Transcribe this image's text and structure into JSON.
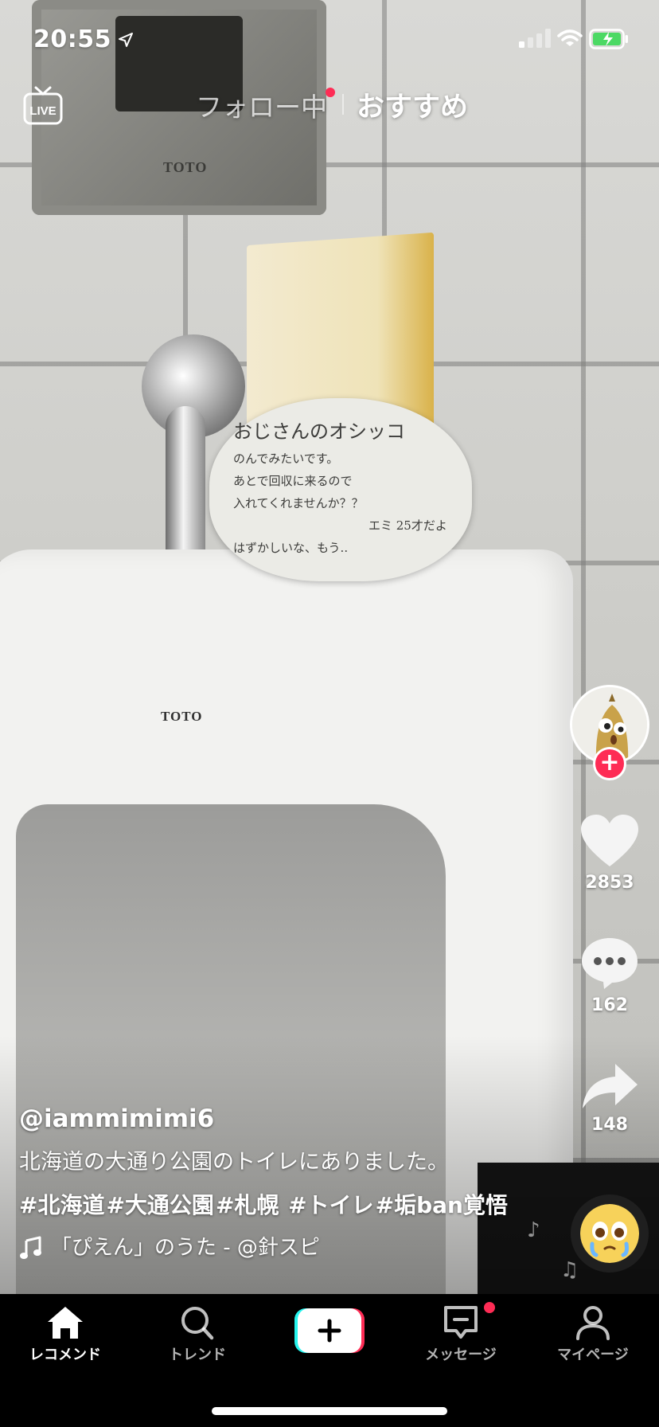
{
  "status_bar": {
    "time": "20:55"
  },
  "top_nav": {
    "live_label": "LIVE",
    "following_tab": "フォロー中",
    "recommended_tab": "おすすめ"
  },
  "video": {
    "scene_text": {
      "brand_top": "TOTO",
      "brand_bowl": "TOTO",
      "note_lines": [
        "おじさんのオシッコ",
        "のんでみたいです。",
        "あとで回収に来るので",
        "入れてくれませんか？？",
        "エミ 25才だよ",
        "はずかしいな、もう.."
      ]
    }
  },
  "actions": {
    "like_count": "2853",
    "comment_count": "162",
    "share_count": "148",
    "follow_symbol": "+"
  },
  "caption": {
    "username": "@iammimimi6",
    "description": "北海道の大通り公園のトイレにありました。",
    "hashtags": [
      "#北海道",
      "#大通公園",
      "#札幌",
      " #トイレ",
      "#垢ban覚悟"
    ],
    "sound": "「ぴえん」のうた - @針スピ"
  },
  "bottom_nav": {
    "home": "レコメンド",
    "discover": "トレンド",
    "inbox": "メッセージ",
    "profile": "マイページ"
  },
  "colors": {
    "accent": "#fe2c55",
    "create_cyan": "#25f4ee",
    "background": "#000000"
  }
}
